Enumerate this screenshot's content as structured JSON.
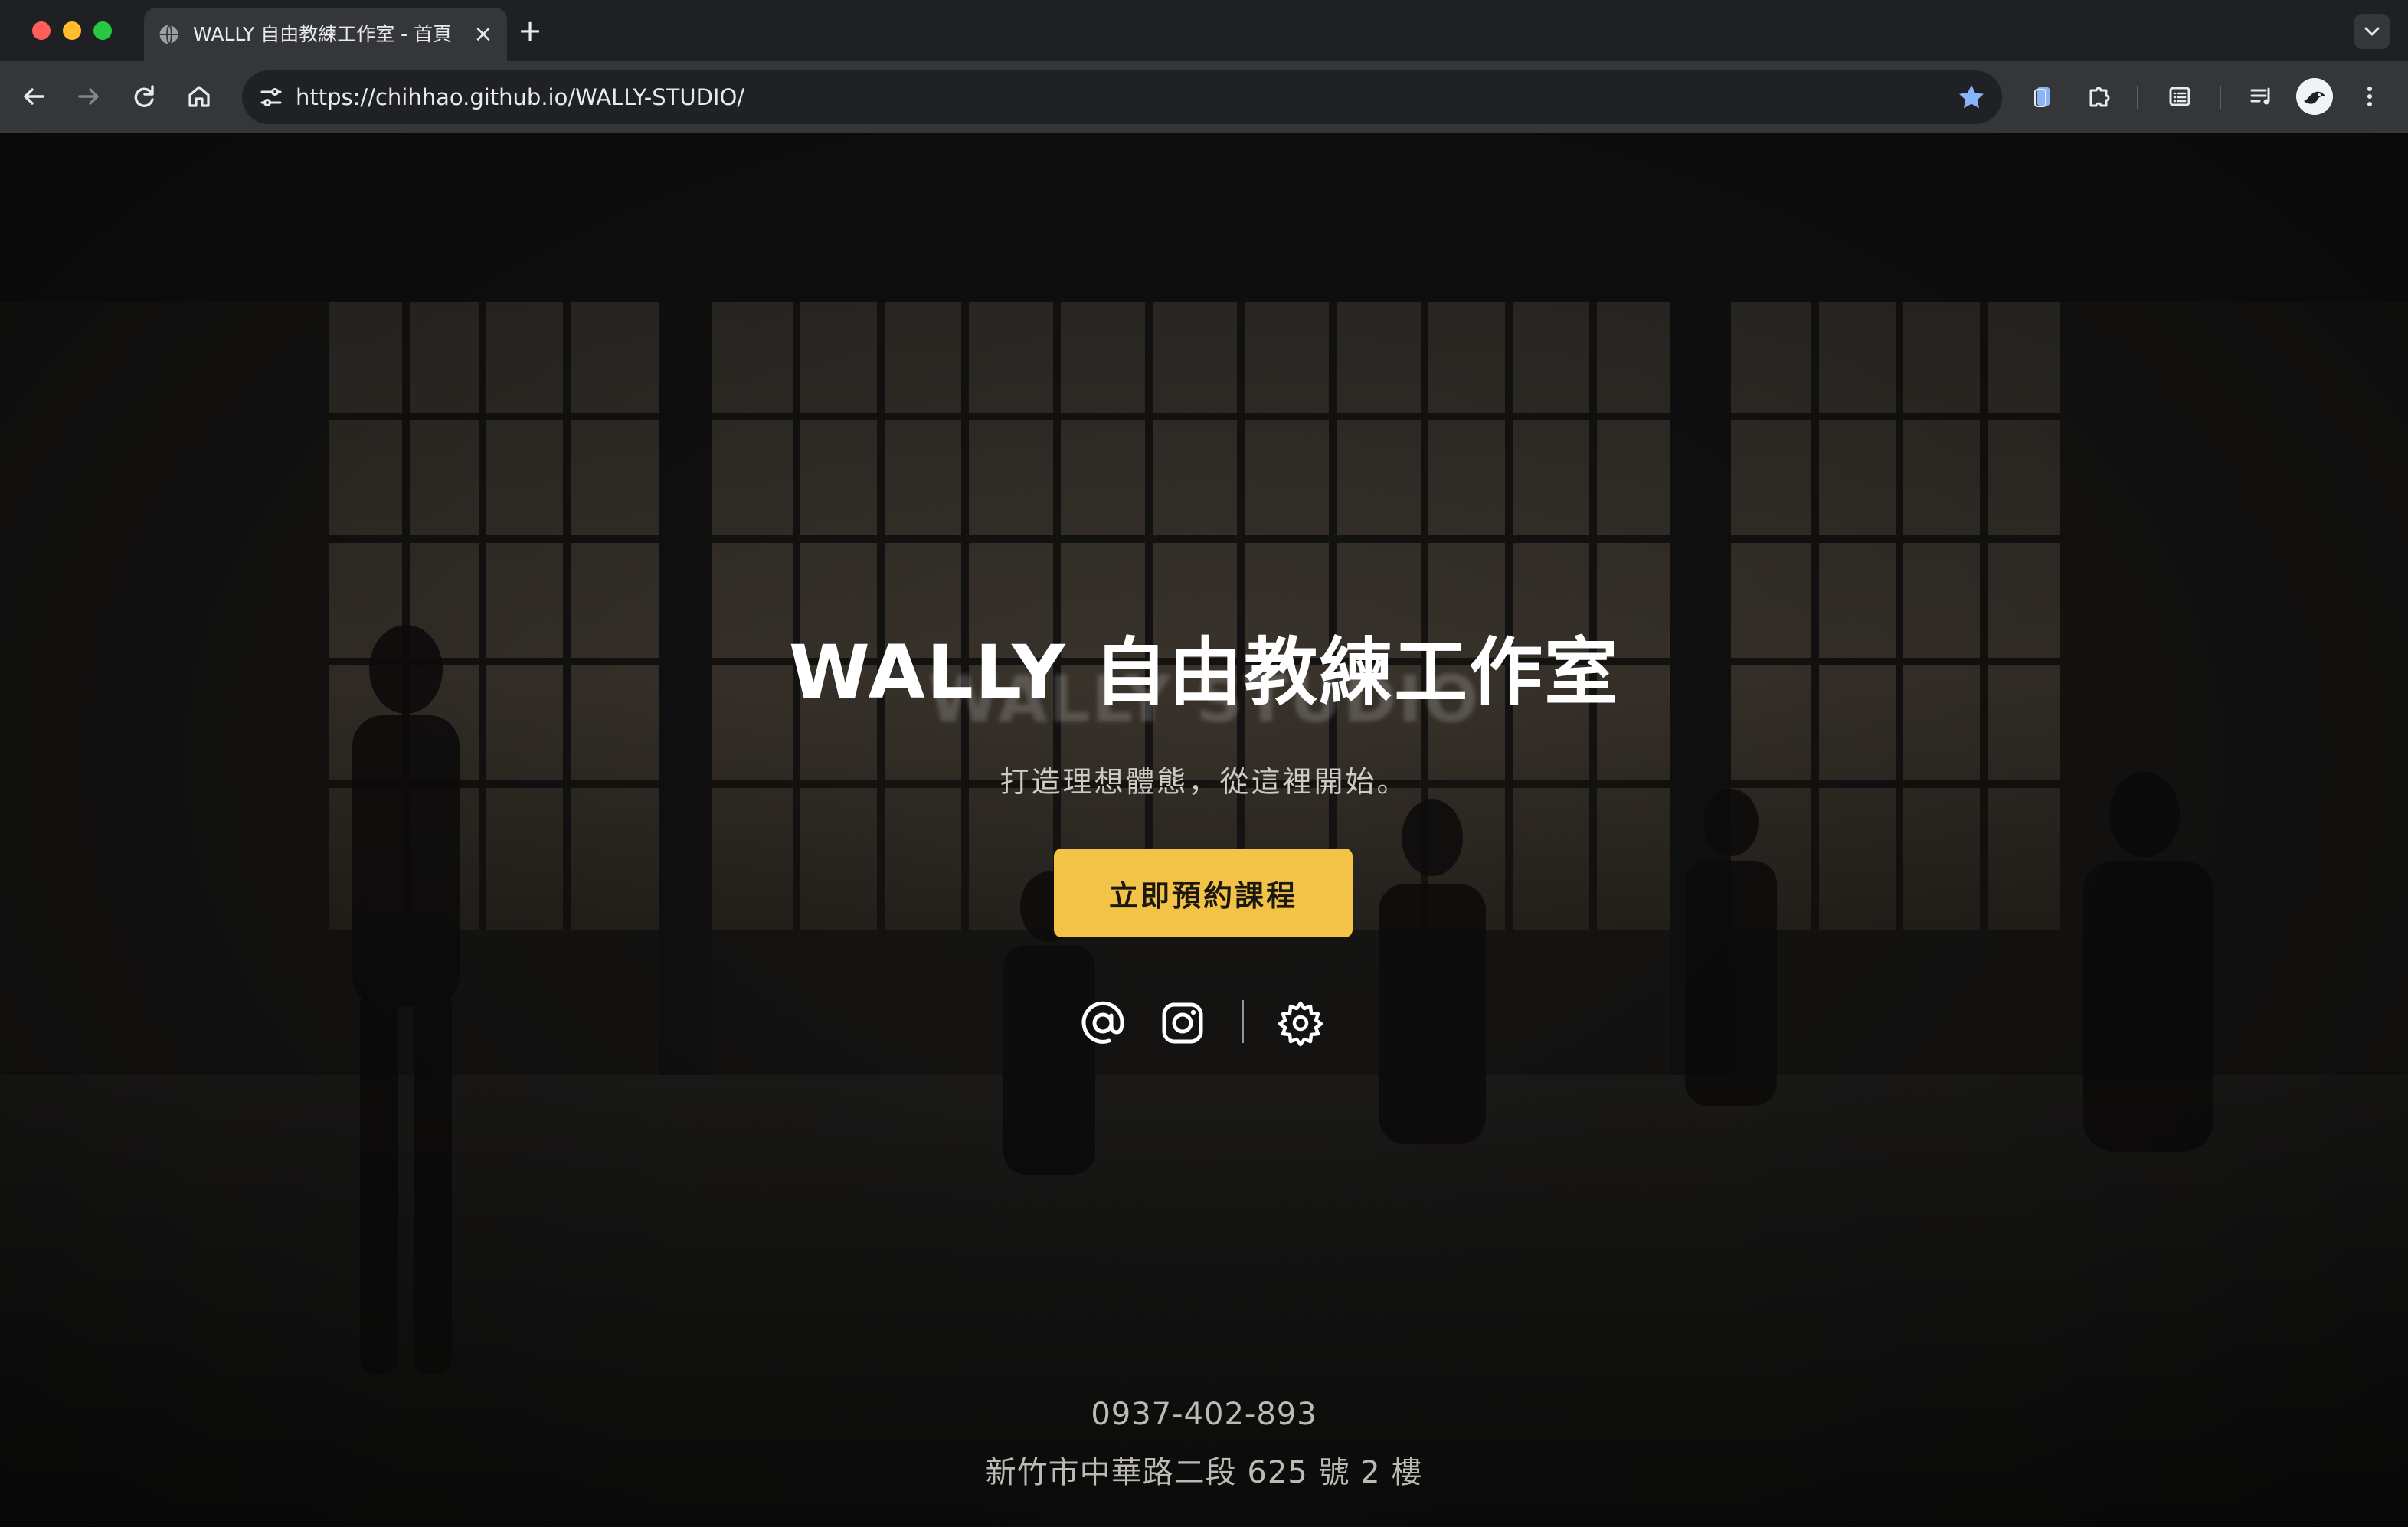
{
  "browser": {
    "tab_title": "WALLY 自由教練工作室 - 首頁",
    "url": "https://chihhao.github.io/WALLY-STUDIO/",
    "icons": {
      "back": "back-arrow-icon",
      "forward": "forward-arrow-icon",
      "reload": "reload-icon",
      "home": "home-icon",
      "site_info": "tune-icon",
      "bookmark": "star-icon",
      "clipboard": "clipboard-icon",
      "extensions": "puzzle-icon",
      "reading_list": "reading-list-icon",
      "media": "media-control-icon",
      "profile": "avatar-icon",
      "menu": "kebab-menu-icon"
    }
  },
  "hero": {
    "title": "WALLY 自由教練工作室",
    "ghost_text": "WALLY STUDIO",
    "subtitle": "打造理想體態，從這裡開始。",
    "cta_label": "立即預約課程",
    "social_icons": [
      "threads-icon",
      "instagram-icon",
      "settings-icon"
    ]
  },
  "contact": {
    "phone": "0937-402-893",
    "address": "新竹市中華路二段 625 號 2 樓"
  },
  "colors": {
    "accent": "#f2c347",
    "chrome_bg": "#1f2023",
    "toolbar_bg": "#35363a",
    "omnibox_bg": "#202124",
    "star": "#8ab4f8"
  }
}
